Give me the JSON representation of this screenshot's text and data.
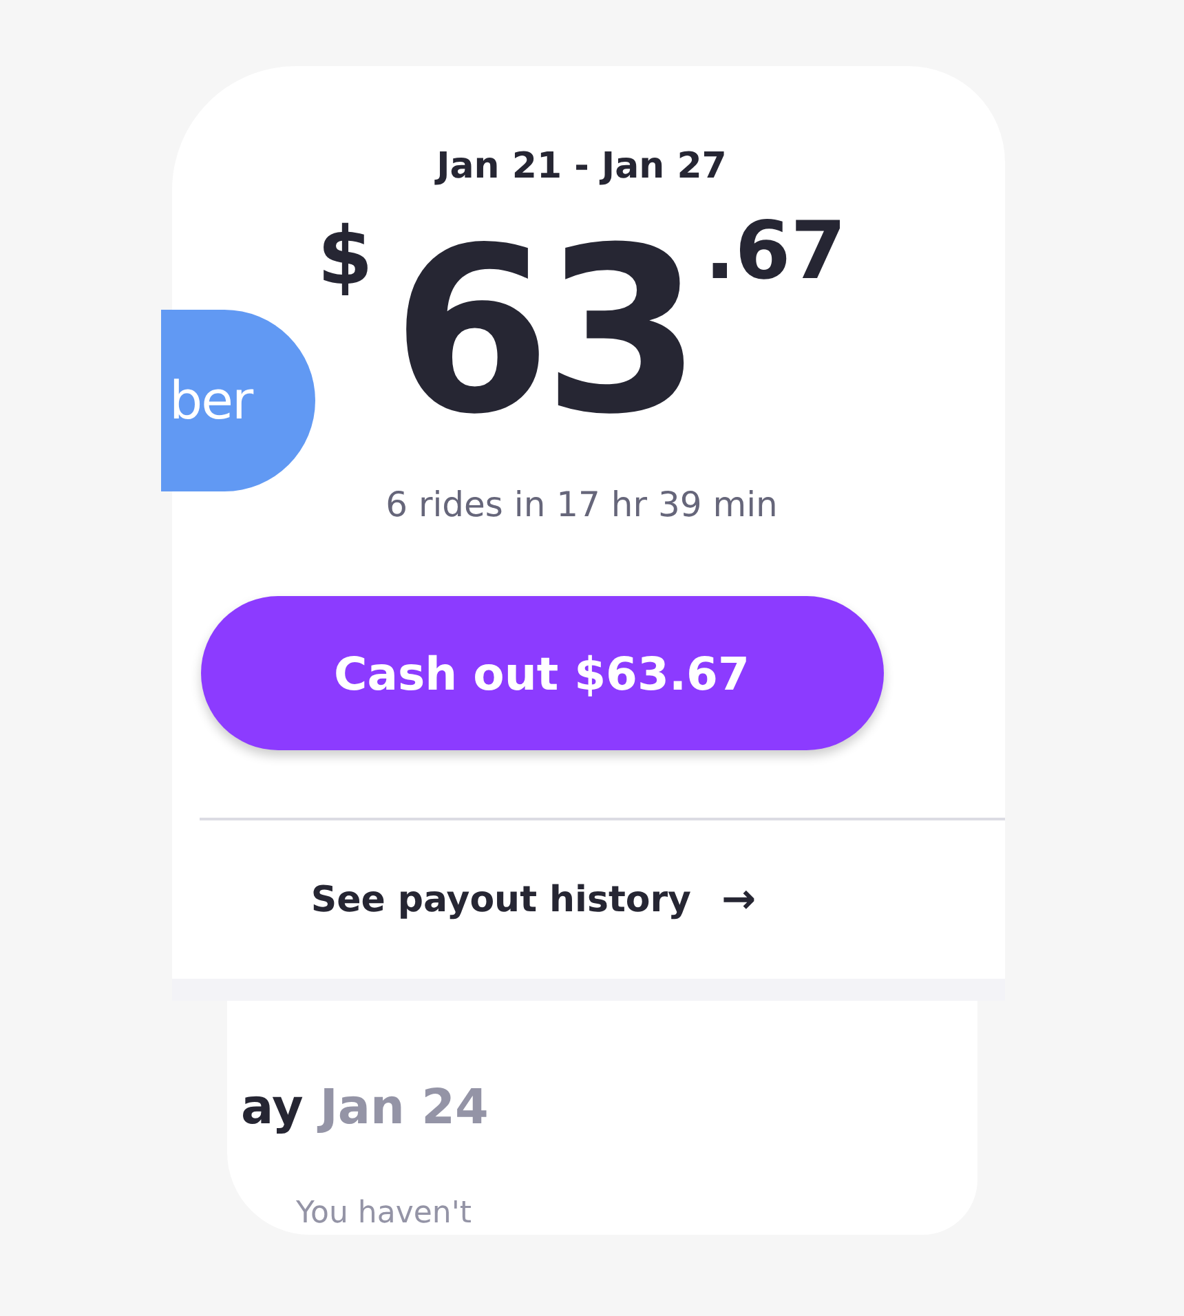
{
  "period": {
    "title": "Jan 21 - Jan 27"
  },
  "earnings": {
    "currency": "$",
    "whole": "63",
    "cents": ".67",
    "summary": "6 rides in 17 hr 39 min"
  },
  "logo": {
    "text": "ber"
  },
  "cash_out_button": {
    "label": "Cash out $63.67"
  },
  "payout_history_link": {
    "label": "See payout history",
    "icon": "→"
  },
  "day": {
    "name": "ay",
    "date": "Jan 24",
    "message": "You haven't"
  }
}
